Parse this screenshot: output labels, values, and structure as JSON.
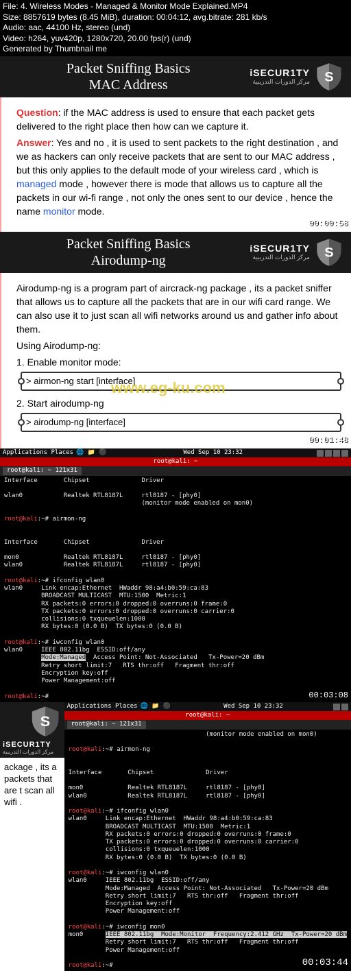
{
  "meta": {
    "file": "File: 4. Wireless Modes - Managed & Monitor Mode Explained.MP4",
    "size": "Size: 8857619 bytes (8.45 MiB), duration: 00:04:12, avg.bitrate: 281 kb/s",
    "audio": "Audio: aac, 44100 Hz, stereo (und)",
    "video": "Video: h264, yuv420p, 1280x720, 20.00 fps(r) (und)",
    "gen": "Generated by Thumbnail me"
  },
  "brand": {
    "main": "iSECUR1TY",
    "ar": "مركز الدورات التدريبية"
  },
  "slide1": {
    "title_l1": "Packet Sniffing Basics",
    "title_l2": "MAC Address",
    "q_label": "Question",
    "q_text": ": if the MAC address is used to ensure that each packet gets delivered to the right place then how can we capture it.",
    "a_label": "Answer",
    "a_pre": ": Yes and no , it is used to sent packets to the right destination , and we as hackers can only receive packets that are sent to our MAC address , but this only applies to the default mode of your wireless card , which is ",
    "a_managed": "managed",
    "a_mid": " mode , however there is mode that allows us to capture all the packets in our wi-fi range , not only the ones sent to our device , hence the name ",
    "a_monitor": "monitor",
    "a_end": " mode.",
    "ts": "00:00:58"
  },
  "slide2": {
    "title_l1": "Packet Sniffing Basics",
    "title_l2": "Airodump-ng",
    "desc": "Airodump-ng is a program part of aircrack-ng package , its a packet sniffer that allows  us to capture all the packets that are in our wifi card range. We can also use it to just scan all wifi networks around us and gather info about them.",
    "using": "Using Airodump-ng:",
    "step1": "1. Enable monitor mode:",
    "cmd1": "> airmon-ng start [interface]",
    "step2": "2. Start airodump-ng",
    "cmd2": "> airodump-ng [interface]",
    "watermark": "www.eg-ku.com",
    "ts": "00:01:48"
  },
  "term1": {
    "panel_apps": "Applications  Places",
    "panel_time": "Wed Sep 10  23:32",
    "titlebar": "root@kali: ~",
    "tab": "root@kali: ~ 121x31",
    "body": "Interface       Chipset              Driver\n\nwlan0           Realtek RTL8187L     rtl8187 - [phy0]\n                                     (monitor mode enabled on mon0)\n\nroot@kali:~# airmon-ng\n\n\nInterface       Chipset              Driver\n\nmon0            Realtek RTL8187L     rtl8187 - [phy0]\nwlan0           Realtek RTL8187L     rtl8187 - [phy0]\n\nroot@kali:~# ifconfig wlan0\nwlan0     Link encap:Ethernet  HWaddr 98:a4:b0:59:ca:83\n          BROADCAST MULTICAST  MTU:1500  Metric:1\n          RX packets:0 errors:0 dropped:0 overruns:0 frame:0\n          TX packets:0 errors:0 dropped:0 overruns:0 carrier:0\n          collisions:0 txqueuelen:1000\n          RX bytes:0 (0.0 B)  TX bytes:0 (0.0 B)\n\nroot@kali:~# iwconfig wlan0\nwlan0     IEEE 802.11bg  ESSID:off/any\n          Mode:Managed  Access Point: Not-Associated   Tx-Power=20 dBm\n          Retry short limit:7   RTS thr:off   Fragment thr:off\n          Encryption key:off\n          Power Management:off\n\nroot@kali:~#",
    "hl": "Mode:Managed",
    "ts": "00:03:08"
  },
  "slide3": {
    "body": "ackage , its a packets that are t scan all wifi ."
  },
  "term2": {
    "panel_apps": "Applications  Places",
    "panel_time": "Wed Sep 10  23:32",
    "titlebar": "root@kali: ~",
    "tab": "root@kali: ~ 121x31",
    "body": "                                     (monitor mode enabled on mon0)\n\nroot@kali:~# airmon-ng\n\n\nInterface       Chipset              Driver\n\nmon0            Realtek RTL8187L     rtl8187 - [phy0]\nwlan0           Realtek RTL8187L     rtl8187 - [phy0]\n\nroot@kali:~# ifconfig wlan0\nwlan0     Link encap:Ethernet  HWaddr 98:a4:b0:59:ca:83\n          BROADCAST MULTICAST  MTU:1500  Metric:1\n          RX packets:0 errors:0 dropped:0 overruns:0 frame:0\n          TX packets:0 errors:0 dropped:0 overruns:0 carrier:0\n          collisions:0 txqueuelen:1000\n          RX bytes:0 (0.0 B)  TX bytes:0 (0.0 B)\n\nroot@kali:~# iwconfig wlan0\nwlan0     IEEE 802.11bg  ESSID:off/any\n          Mode:Managed  Access Point: Not-Associated   Tx-Power=20 dBm\n          Retry short limit:7   RTS thr:off   Fragment thr:off\n          Encryption key:off\n          Power Management:off\n\nroot@kali:~# iwconfig mon0\nmon0      IEEE 802.11bg  Mode:Monitor  Frequency:2.412 GHz  Tx-Power=20 dBm\n          Retry short limit:7   RTS thr:off   Fragment thr:off\n          Power Management:off\n\nroot@kali:~#",
    "hl": "IEEE 802.11bg  Mode:Monitor  Frequency:2.412 GHz  Tx-Power=20 dBm"
  },
  "footer_ts": "00:03:44"
}
